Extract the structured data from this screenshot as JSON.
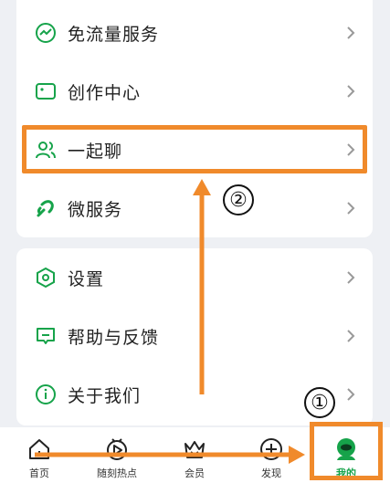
{
  "menu_top": [
    {
      "label": "免流量服务",
      "icon": "trend-circle-icon"
    },
    {
      "label": "创作中心",
      "icon": "video-icon"
    },
    {
      "label": "一起聊",
      "icon": "users-icon"
    },
    {
      "label": "微服务",
      "icon": "link-icon"
    }
  ],
  "menu_bottom": [
    {
      "label": "设置",
      "icon": "settings-hex-icon"
    },
    {
      "label": "帮助与反馈",
      "icon": "feedback-icon"
    },
    {
      "label": "关于我们",
      "icon": "info-icon"
    }
  ],
  "annotations": {
    "step1": "①",
    "step2": "②"
  },
  "tabbar": [
    {
      "label": "首页",
      "icon": "home-icon"
    },
    {
      "label": "随刻热点",
      "icon": "play-hot-icon"
    },
    {
      "label": "会员",
      "icon": "crown-icon"
    },
    {
      "label": "发现",
      "icon": "plus-circle-icon"
    },
    {
      "label": "我的",
      "icon": "profile-icon",
      "active": true
    }
  ],
  "colors": {
    "accent_green": "#16a34a",
    "annotation_orange": "#f08a2b"
  }
}
